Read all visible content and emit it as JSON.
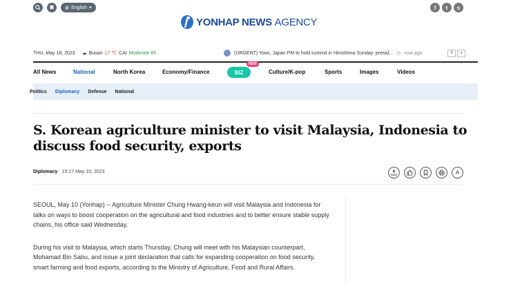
{
  "header": {
    "language": "English",
    "logo_bold": "YONHAP NEWS",
    "logo_light": "AGENCY",
    "social": [
      "f",
      "t",
      "s"
    ]
  },
  "infobar": {
    "date": "THU, May 18, 2023",
    "city": "Busan",
    "temp": "17 ℃",
    "cai_label": "CAI",
    "cai_value": "Moderate 85",
    "headline": "(URGENT) Yoon, Japan PM to hold summit in Hiroshima Sunday: presid...",
    "ago": "now ago",
    "pause": "II",
    "expand": "v"
  },
  "nav": {
    "items": [
      "All News",
      "National",
      "North Korea",
      "Economy/Finance",
      "BIZ",
      "Culture/K-pop",
      "Sports",
      "Images",
      "Videos"
    ],
    "new_badge": "NEW"
  },
  "subnav": {
    "items": [
      "Politics",
      "Diplomacy",
      "Defense",
      "National"
    ]
  },
  "article": {
    "title": "S. Korean agriculture minister to visit Malaysia, Indonesia to discuss food security, exports",
    "section": "Diplomacy",
    "timestamp": "15:17 May 10, 2023",
    "paragraphs": [
      "SEOUL, May 10 (Yonhap) -- Agriculture Minister Chung Hwang-keun will visit Malaysia and Indonesia for talks on ways to boost cooperation on the agricultural and food industries and to better ensure stable supply chains, his office said Wednesday.",
      "During his visit to Malaysia, which starts Thursday, Chung will meet with his Malaysian counterpart, Mohamad Bin Sabu, and issue a joint declaration that calls for expanding cooperation on food security, smart farming and food exports, according to the Ministry of Agriculture, Food and Rural Affairs."
    ]
  },
  "tools": [
    "share-icon",
    "like-icon",
    "bookmark-icon",
    "print-icon",
    "font-size-icon"
  ],
  "tool_font_label": "A"
}
